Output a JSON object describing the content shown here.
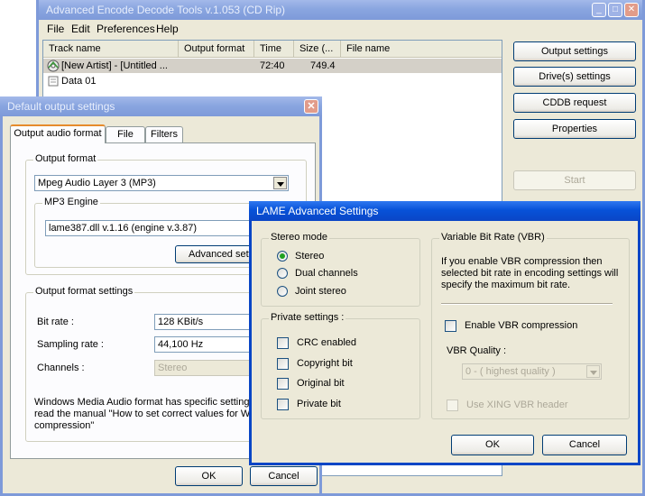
{
  "main_window": {
    "title": "Advanced Encode Decode Tools v.1.053 (CD Rip)",
    "controls": {
      "minimize": "_",
      "maximize": "□",
      "close": "✕"
    },
    "menu": [
      "File",
      "Edit",
      "Preferences",
      "Help"
    ],
    "columns": [
      "Track name",
      "Output format",
      "Time",
      "Size (...",
      "File name"
    ],
    "rows": [
      {
        "track": "[New Artist] - [Untitled ...",
        "format": "",
        "time": "72:40",
        "size": "749.4",
        "file": ""
      },
      {
        "track": "Data 01",
        "format": "",
        "time": "",
        "size": "",
        "file": ""
      }
    ],
    "buttons": {
      "output_settings": "Output settings",
      "drives_settings": "Drive(s) settings",
      "cddb_request": "CDDB request",
      "properties": "Properties",
      "start": "Start"
    }
  },
  "output_dialog": {
    "title": "Default output settings",
    "close": "✕",
    "tabs": [
      "Output audio format",
      "File",
      "Filters"
    ],
    "output_format_group": "Output format",
    "output_format_value": "Mpeg Audio Layer 3 (MP3)",
    "engine_group": "MP3 Engine",
    "engine_value": "lame387.dll v.1.16 (engine v.3.87)",
    "advanced_button": "Advanced sett",
    "settings_group": "Output format settings",
    "bitrate_label": "Bit rate :",
    "bitrate_value": "128 KBit/s",
    "sampling_label": "Sampling rate :",
    "sampling_value": "44,100 Hz",
    "channels_label": "Channels :",
    "channels_value": "Stereo",
    "note_line1": "Windows Media Audio format has specific settings,",
    "note_line2": "read the manual \"How to set correct values for WM",
    "note_line3": "compression\"",
    "ok": "OK",
    "cancel": "Cancel"
  },
  "lame_dialog": {
    "title": "LAME Advanced Settings",
    "stereo_group": "Stereo mode",
    "stereo_options": [
      "Stereo",
      "Dual channels",
      "Joint stereo"
    ],
    "stereo_selected": "Stereo",
    "private_group": "Private settings :",
    "private_options": [
      "CRC enabled",
      "Copyright bit",
      "Original bit",
      "Private bit"
    ],
    "vbr_group": "Variable Bit Rate (VBR)",
    "vbr_info_line1": "If you enable VBR compression then",
    "vbr_info_line2": "selected bit rate in encoding settings will",
    "vbr_info_line3": "specify the maximum bit rate.",
    "enable_vbr": "Enable VBR compression",
    "vbr_quality_label": "VBR Quality :",
    "vbr_quality_value": "0 - ( highest quality )",
    "xing_header": "Use XING VBR header",
    "ok": "OK",
    "cancel": "Cancel"
  },
  "colors": {
    "title_active": "#0a46c6",
    "title_inactive": "#7e9ad9",
    "dialog_bg": "#ece9d8",
    "tab_accent": "#e68b2c",
    "radio_dot": "#21a121"
  }
}
